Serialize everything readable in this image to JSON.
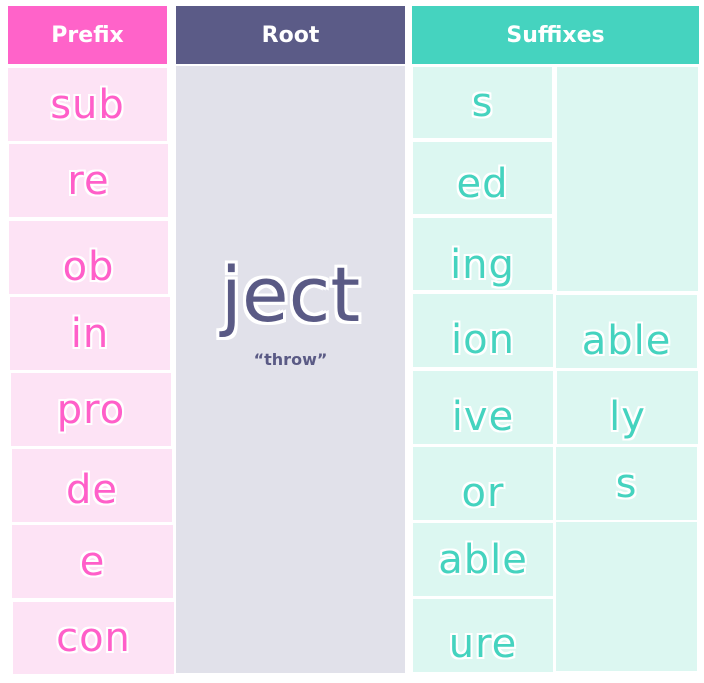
{
  "headers": {
    "prefix": "Prefix",
    "root": "Root",
    "suffixes": "Suffixes"
  },
  "colors": {
    "prefix_header": "#ff63c9",
    "prefix_cell": "#fde3f5",
    "prefix_text": "#ff5fc9",
    "root_header": "#5b5b87",
    "root_cell": "#e1e1ea",
    "root_text": "#5a5a85",
    "suffix_header": "#45d3bf",
    "suffix_cell": "#dcf7f1",
    "suffix_text": "#45d3bf"
  },
  "prefixes": [
    "sub",
    "re",
    "ob",
    "in",
    "pro",
    "de",
    "e",
    "con"
  ],
  "root": {
    "word": "ject",
    "meaning": "“throw”"
  },
  "suffixes_col1": [
    "s",
    "ed",
    "ing",
    "ion",
    "ive",
    "or",
    "able",
    "ure"
  ],
  "suffixes_col2": [
    "",
    "able",
    "ly",
    "s",
    ""
  ]
}
